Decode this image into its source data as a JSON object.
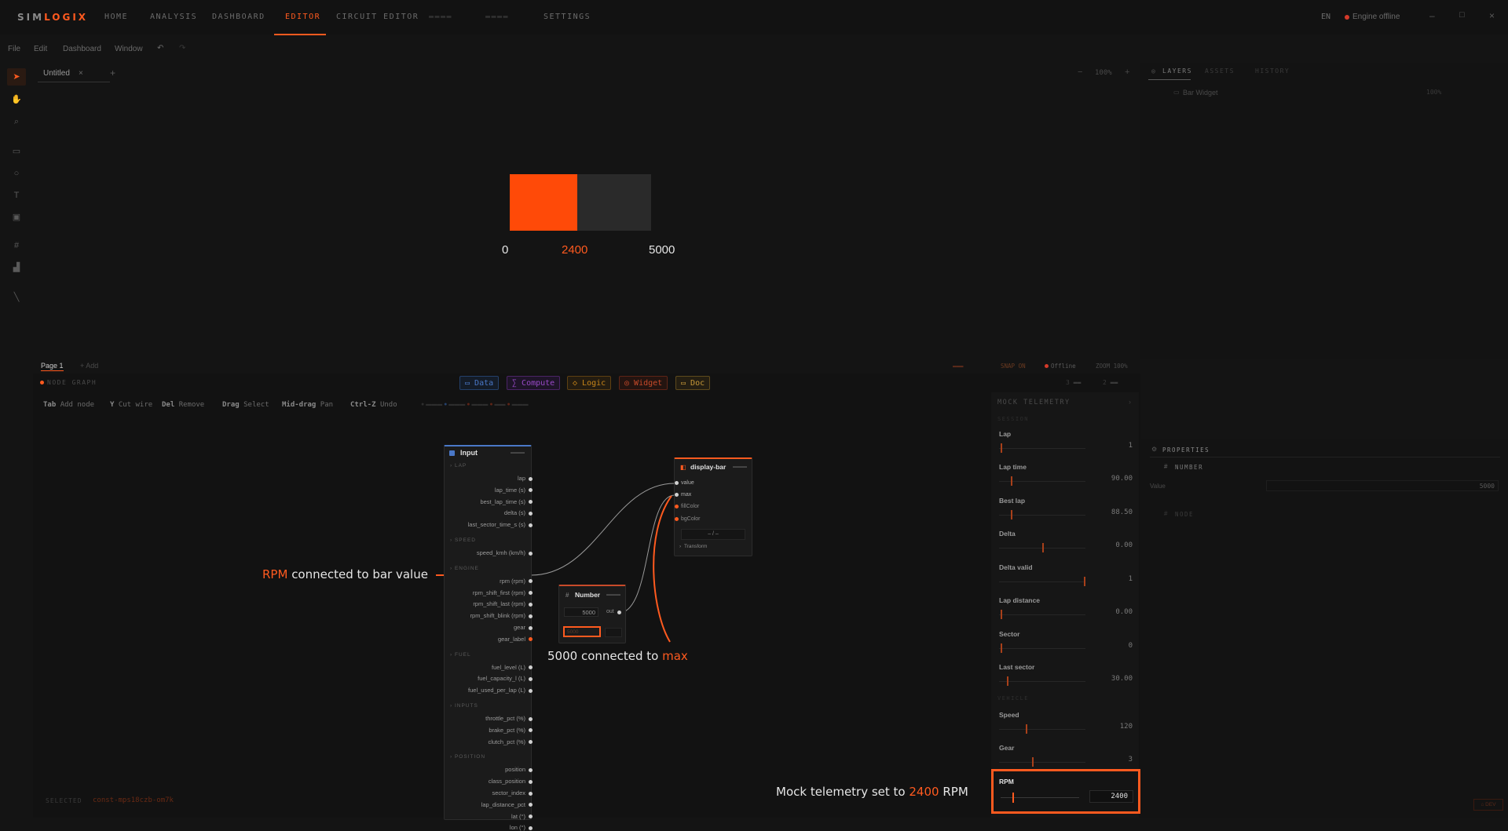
{
  "app": {
    "logo_part1": "SIM",
    "logo_part2": "LOGIX"
  },
  "nav": {
    "items": [
      "HOME",
      "ANALYSIS",
      "DASHBOARD",
      "EDITOR",
      "CIRCUIT EDITOR",
      "SETTINGS"
    ],
    "active": "EDITOR"
  },
  "status": {
    "lang": "EN",
    "engine": "Engine offline"
  },
  "menu": {
    "items": [
      "File",
      "Edit",
      "Dashboard",
      "Window"
    ]
  },
  "document": {
    "tab": "Untitled",
    "zoom": "100%"
  },
  "layers_panel": {
    "tabs": [
      "LAYERS",
      "ASSETS",
      "HISTORY"
    ],
    "layer": "Bar Widget",
    "layer_opacity": "100%"
  },
  "bar_widget": {
    "min_label": "0",
    "value_label": "2400",
    "max_label": "5000",
    "value": 2400,
    "max": 5000,
    "fill_color": "#ff4a08",
    "bg_color": "#2a2a2a"
  },
  "pages": {
    "active": "Page 1",
    "add": "+ Add"
  },
  "graph_toolbar": {
    "title": "NODE GRAPH",
    "right_items": [
      "SNAP ON",
      "Offline",
      "ZOOM 100%"
    ],
    "categories": [
      "Data",
      "Compute",
      "Logic",
      "Widget",
      "Doc"
    ],
    "category_colors": [
      "#4a78c8",
      "#9a4ac8",
      "#c8861a",
      "#c84a2a",
      "#c89a3a"
    ]
  },
  "hints": [
    {
      "key": "Tab",
      "action": "Add node"
    },
    {
      "key": "Y",
      "action": "Cut wire"
    },
    {
      "key": "Del",
      "action": "Remove"
    },
    {
      "key": "Drag",
      "action": "Select"
    },
    {
      "key": "Mid-drag",
      "action": "Pan"
    },
    {
      "key": "Ctrl-Z",
      "action": "Undo"
    }
  ],
  "input_node": {
    "title": "Input",
    "groups": [
      {
        "name": "LAP",
        "ports": [
          "lap",
          "lap_time (s)",
          "best_lap_time (s)",
          "delta (s)",
          "last_sector_time_s (s)"
        ]
      },
      {
        "name": "SPEED",
        "ports": [
          "speed_kmh (km/h)"
        ]
      },
      {
        "name": "ENGINE",
        "ports": [
          "rpm (rpm)",
          "rpm_shift_first (rpm)",
          "rpm_shift_last (rpm)",
          "rpm_shift_blink (rpm)",
          "gear",
          "gear_label"
        ]
      },
      {
        "name": "FUEL",
        "ports": [
          "fuel_level (L)",
          "fuel_capacity_l (L)",
          "fuel_used_per_lap (L)"
        ]
      },
      {
        "name": "INPUTS",
        "ports": [
          "throttle_pct (%)",
          "brake_pct (%)",
          "clutch_pct (%)"
        ]
      },
      {
        "name": "POSITION",
        "ports": [
          "position",
          "class_position",
          "sector_index",
          "lap_distance_pct",
          "lat (°)",
          "lon (°)"
        ]
      }
    ]
  },
  "number_node": {
    "title": "Number",
    "value": "5000",
    "out_label": "out",
    "sub_value": "5000"
  },
  "display_node": {
    "title": "display-bar",
    "ports": [
      "value",
      "max",
      "fillColor",
      "bgColor"
    ],
    "select": "– / –",
    "transform": "Transform"
  },
  "annotations": {
    "a1_hl": "RPM",
    "a1_rest": " connected to bar value",
    "a2_pre": "5000 connected to ",
    "a2_hl": "max",
    "a3_pre": "Mock telemetry set to ",
    "a3_hl": "2400",
    "a3_post": " RPM"
  },
  "mock_telemetry": {
    "title": "MOCK TELEMETRY",
    "section_lap": "SESSION",
    "section_speed": "VEHICLE",
    "fields": [
      {
        "label": "Lap",
        "value": "1",
        "level": 0.0
      },
      {
        "label": "Lap time",
        "value": "90.00",
        "level": 0.12
      },
      {
        "label": "Best lap",
        "value": "88.50",
        "level": 0.12
      },
      {
        "label": "Delta",
        "value": "0.00",
        "level": 0.5
      },
      {
        "label": "Delta valid",
        "value": "1",
        "level": 1.0
      },
      {
        "label": "Lap distance",
        "value": "0.00",
        "level": 0.0
      },
      {
        "label": "Sector",
        "value": "0",
        "level": 0.0
      },
      {
        "label": "Last sector",
        "value": "30.00",
        "level": 0.08
      },
      {
        "label": "Speed",
        "value": "120",
        "level": 0.3
      },
      {
        "label": "Gear",
        "value": "3",
        "level": 0.38
      }
    ],
    "rpm": {
      "label": "RPM",
      "value": "2400",
      "level": 0.15
    }
  },
  "properties": {
    "title": "PROPERTIES",
    "section": "NUMBER",
    "value_label": "Value",
    "value": "5000",
    "node_section": "NODE"
  },
  "footer": {
    "selected_label": "SELECTED",
    "selected_id": "const-mps18czb-om7k"
  }
}
